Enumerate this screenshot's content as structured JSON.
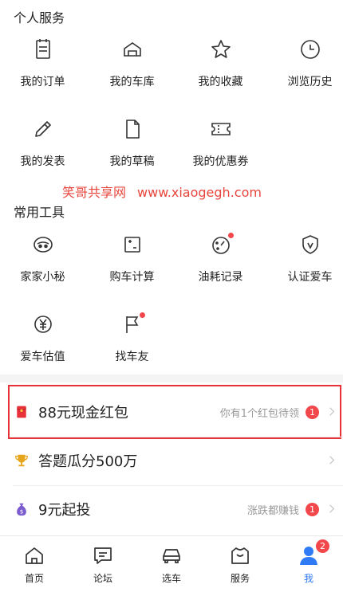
{
  "personal": {
    "title": "个人服务",
    "items": [
      {
        "label": "我的订单",
        "icon": "order-icon"
      },
      {
        "label": "我的车库",
        "icon": "garage-icon"
      },
      {
        "label": "我的收藏",
        "icon": "star-icon"
      },
      {
        "label": "浏览历史",
        "icon": "clock-icon"
      },
      {
        "label": "我的发表",
        "icon": "pencil-icon"
      },
      {
        "label": "我的草稿",
        "icon": "draft-icon"
      },
      {
        "label": "我的优惠券",
        "icon": "coupon-icon"
      }
    ]
  },
  "watermark": {
    "text": "笑哥共享网",
    "url": "www.xiaogegh.com"
  },
  "tools": {
    "title": "常用工具",
    "items": [
      {
        "label": "家家小秘",
        "icon": "robot-icon"
      },
      {
        "label": "购车计算",
        "icon": "calculator-icon"
      },
      {
        "label": "油耗记录",
        "icon": "fuel-gauge-icon"
      },
      {
        "label": "认证爱车",
        "icon": "verified-shield-icon"
      },
      {
        "label": "爱车估值",
        "icon": "yuan-icon"
      },
      {
        "label": "找车友",
        "icon": "flag-icon"
      }
    ]
  },
  "rows": [
    {
      "title": "88元现金红包",
      "hint": "你有1个红包待领",
      "badge": "1",
      "icon": "red-envelope-icon"
    },
    {
      "title": "答题瓜分500万",
      "hint": "",
      "badge": "",
      "icon": "trophy-icon"
    },
    {
      "title": "9元起投",
      "hint": "涨跌都赚钱",
      "badge": "1",
      "icon": "money-bag-icon"
    }
  ],
  "tabbar": {
    "items": [
      {
        "label": "首页",
        "icon": "home-icon"
      },
      {
        "label": "论坛",
        "icon": "forum-icon"
      },
      {
        "label": "选车",
        "icon": "car-icon"
      },
      {
        "label": "服务",
        "icon": "service-icon"
      },
      {
        "label": "我",
        "icon": "user-icon",
        "badge": "2"
      }
    ]
  },
  "colors": {
    "accent": "#2f7bf5",
    "badge": "#f2474b",
    "highlight": "#e8323a"
  }
}
